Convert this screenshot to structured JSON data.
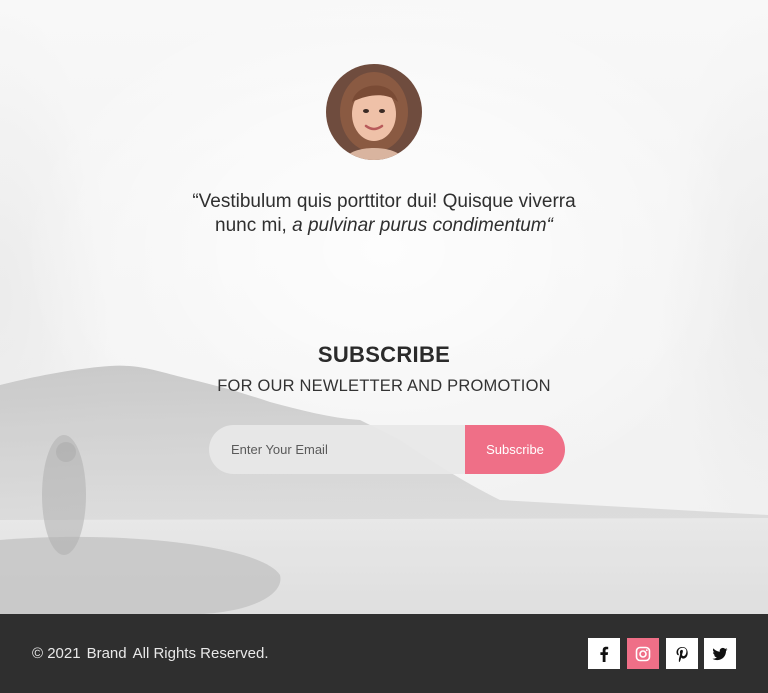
{
  "testimonial": {
    "avatar_icon": "person-avatar",
    "quote_plain": "“Vestibulum quis porttitor dui! Quisque viverra nunc mi, ",
    "quote_italic": "a pulvinar purus condimentum",
    "quote_close": "“"
  },
  "subscribe": {
    "title": "SUBSCRIBE",
    "tagline": "FOR OUR NEWLETTER AND PROMOTION",
    "email_placeholder": "Enter Your Email",
    "email_value": "",
    "button_label": "Subscribe"
  },
  "footer": {
    "copyright_symbol_year": "© 2021",
    "brand": "Brand",
    "rights": "All Rights Reserved.",
    "social": [
      {
        "name": "facebook-icon"
      },
      {
        "name": "instagram-icon"
      },
      {
        "name": "pinterest-icon"
      },
      {
        "name": "twitter-icon"
      }
    ]
  },
  "colors": {
    "accent": "#ef6f87",
    "footer_bg": "#2f2f2f",
    "text_dark": "#2b2b2b"
  }
}
